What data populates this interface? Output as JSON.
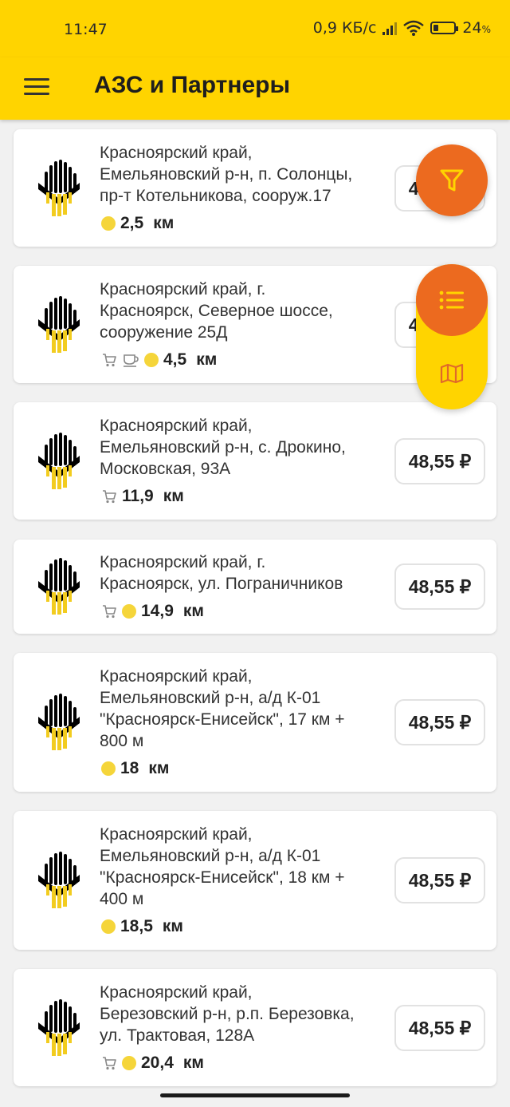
{
  "status_bar": {
    "time": "11:47",
    "network_speed": "0,9 КБ/с",
    "battery": "24",
    "battery_suffix": "%",
    "battery_level": 0.24
  },
  "app_bar": {
    "title": "АЗС и Партнеры",
    "menu_icon": "hamburger-icon"
  },
  "fab": {
    "filter_icon": "filter-icon",
    "list_icon": "list-icon",
    "map_icon": "map-icon"
  },
  "stations": [
    {
      "address": [
        "Красноярский край,",
        "Емельяновский р-н, п. Солонцы,",
        "пр-т Котельникова, сооруж.17"
      ],
      "distance": "2,5",
      "unit": "км",
      "price": "48,55 ₽",
      "amenities": [
        "fuel"
      ]
    },
    {
      "address": [
        "Красноярский край, г.",
        "Красноярск, Северное шоссе,",
        "сооружение 25Д"
      ],
      "distance": "4,5",
      "unit": "км",
      "price": "48,55 ₽",
      "amenities": [
        "shop",
        "cafe",
        "fuel"
      ]
    },
    {
      "address": [
        "Красноярский край,",
        "Емельяновский р-н, с. Дрокино,",
        "Московская, 93А"
      ],
      "distance": "11,9",
      "unit": "км",
      "price": "48,55 ₽",
      "amenities": [
        "shop"
      ]
    },
    {
      "address": [
        "Красноярский край, г.",
        "Красноярск, ул. Пограничников"
      ],
      "distance": "14,9",
      "unit": "км",
      "price": "48,55 ₽",
      "amenities": [
        "shop",
        "fuel"
      ]
    },
    {
      "address": [
        "Красноярский край,",
        "Емельяновский р-н, а/д К-01",
        "\"Красноярск-Енисейск\", 17 км +",
        "800 м"
      ],
      "distance": "18",
      "unit": "км",
      "price": "48,55 ₽",
      "amenities": [
        "fuel"
      ]
    },
    {
      "address": [
        "Красноярский край,",
        "Емельяновский р-н, а/д К-01",
        "\"Красноярск-Енисейск\", 18 км +",
        "400 м"
      ],
      "distance": "18,5",
      "unit": "км",
      "price": "48,55 ₽",
      "amenities": [
        "fuel"
      ]
    },
    {
      "address": [
        "Красноярский край,",
        "Березовский р-н, р.п. Березовка,",
        "ул. Трактовая, 128А"
      ],
      "distance": "20,4",
      "unit": "км",
      "price": "48,55 ₽",
      "amenities": [
        "shop",
        "fuel"
      ]
    }
  ],
  "colors": {
    "brand_yellow": "#ffd400",
    "accent_orange": "#ec6a1f",
    "fuel_dot": "#f5d53a"
  }
}
